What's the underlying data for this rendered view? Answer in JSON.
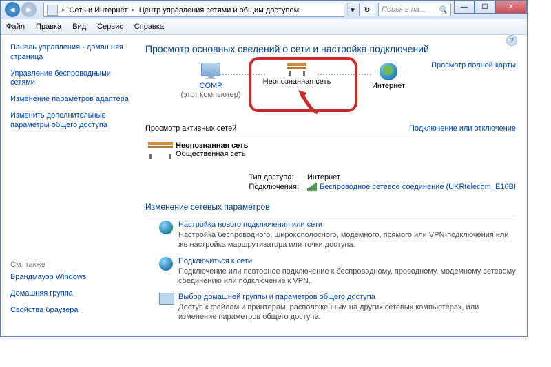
{
  "breadcrumb": {
    "icon": "network-center-icon",
    "part1": "Сеть и Интернет",
    "part2": "Центр управления сетями и общим доступом"
  },
  "search": {
    "placeholder": "Поиск в па...",
    "icon": "search-icon"
  },
  "window_buttons": {
    "min": "—",
    "max": "☐",
    "close": "✕"
  },
  "menubar": [
    "Файл",
    "Правка",
    "Вид",
    "Сервис",
    "Справка"
  ],
  "sidebar": {
    "links": [
      "Панель управления - домашняя страница",
      "Управление беспроводными сетями",
      "Изменение параметров адаптера",
      "Изменить дополнительные параметры общего доступа"
    ],
    "see_also_head": "См. также",
    "see_also": [
      "Брандмауэр Windows",
      "Домашняя группа",
      "Свойства браузера"
    ]
  },
  "content": {
    "title": "Просмотр основных сведений о сети и настройка подключений",
    "map_link": "Просмотр полной карты",
    "nodes": {
      "comp": {
        "label": "COMP",
        "sub": "(этот компьютер)"
      },
      "unknown": {
        "label": "Неопознанная сеть"
      },
      "internet": {
        "label": "Интернет"
      }
    },
    "active_label": "Просмотр активных сетей",
    "conn_link": "Подключение или отключение",
    "network": {
      "title": "Неопознанная сеть",
      "subtitle": "Общественная сеть"
    },
    "details": {
      "access_k": "Тип доступа:",
      "access_v": "Интернет",
      "conn_k": "Подключения:",
      "conn_v": "Беспроводное сетевое соединение (UKRtelecom_E16BI"
    },
    "change_head": "Изменение сетевых параметров",
    "tasks": [
      {
        "icon": "new-connection-icon",
        "title": "Настройка нового подключения или сети",
        "desc": "Настройка беспроводного, широкополосного, модемного, прямого или VPN-подключения или же настройка маршрутизатора или точки доступа."
      },
      {
        "icon": "connect-network-icon",
        "title": "Подключиться к сети",
        "desc": "Подключение или повторное подключение к беспроводному, проводному, модемному сетевому соединению или подключение к VPN."
      },
      {
        "icon": "homegroup-icon",
        "title": "Выбор домашней группы и параметров общего доступа",
        "desc": "Доступ к файлам и принтерам, расположенным на других сетевых компьютерах, или изменение параметров общего доступа."
      }
    ]
  }
}
